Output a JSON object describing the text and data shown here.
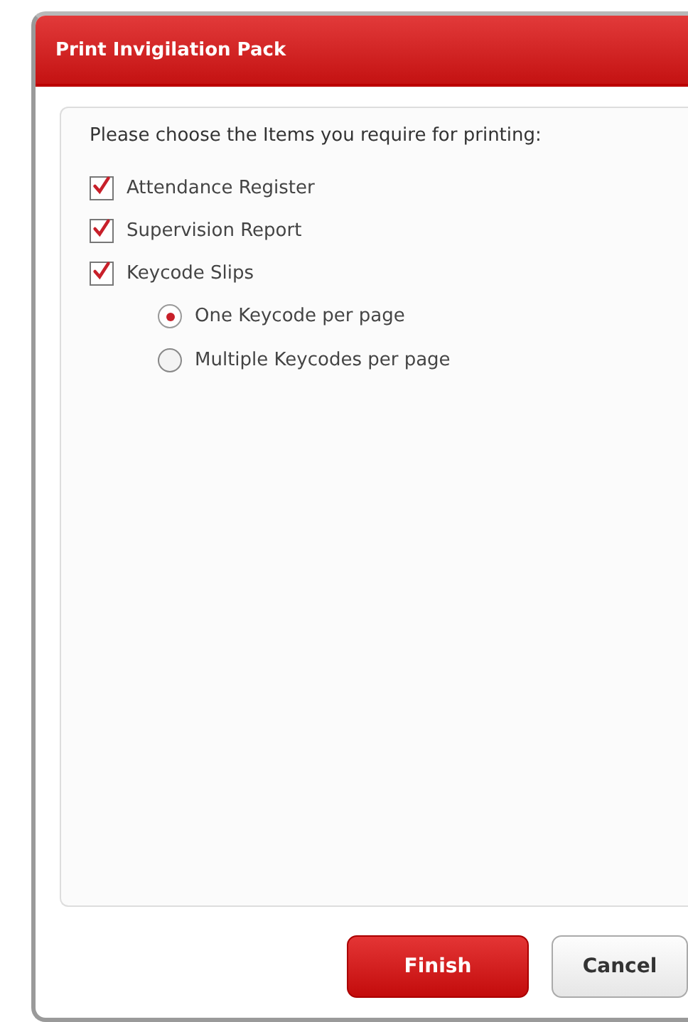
{
  "dialog": {
    "title": "Print Invigilation Pack"
  },
  "prompt": "Please choose the Items you require for printing:",
  "options": [
    {
      "label": "Attendance Register",
      "checked": true
    },
    {
      "label": "Supervision Report",
      "checked": true
    },
    {
      "label": "Keycode Slips",
      "checked": true
    }
  ],
  "keycode_layout": [
    {
      "label": "One Keycode per page",
      "selected": true
    },
    {
      "label": "Multiple Keycodes per page",
      "selected": false
    }
  ],
  "buttons": [
    {
      "label": "Finish",
      "kind": "primary"
    },
    {
      "label": "Cancel",
      "kind": "secondary"
    }
  ]
}
